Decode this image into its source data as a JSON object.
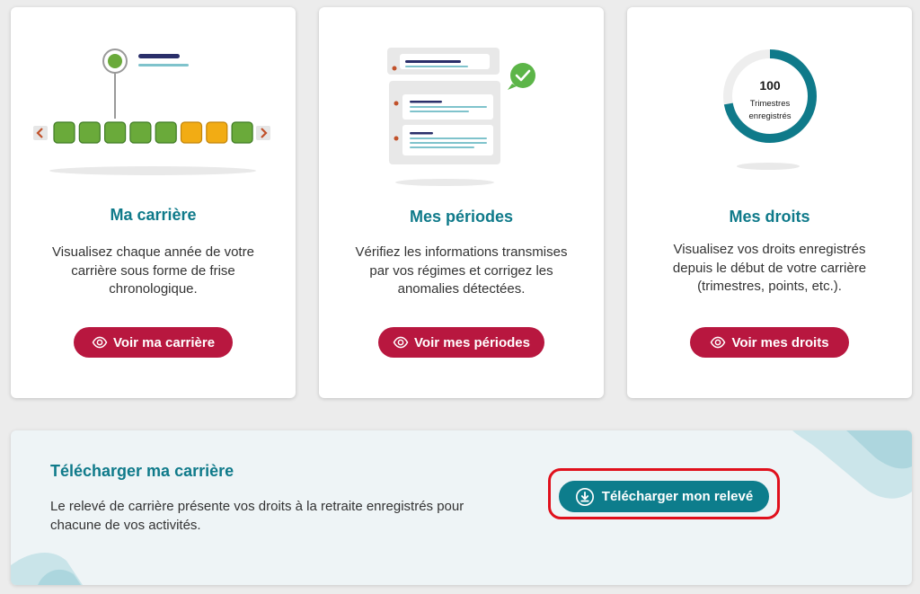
{
  "cards": [
    {
      "title": "Ma carrière",
      "description": "Visualisez chaque année de votre carrière sous forme de frise chronologique.",
      "button_label": "Voir ma carrière",
      "button_icon": "eye-icon"
    },
    {
      "title": "Mes périodes",
      "description": "Vérifiez les informations transmises par vos régimes et corrigez les anomalies détectées.",
      "button_label": "Voir mes périodes",
      "button_icon": "eye-icon"
    },
    {
      "title": "Mes droits",
      "description": "Visualisez vos droits enregistrés depuis le début de votre carrière (trimestres, points, etc.).",
      "button_label": "Voir mes droits",
      "button_icon": "eye-icon"
    }
  ],
  "droits_gauge": {
    "value": "100",
    "caption_line1": "Trimestres",
    "caption_line2": "enregistrés",
    "fill_fraction": 0.72
  },
  "timeline": {
    "blocks": [
      "green",
      "green",
      "green",
      "green",
      "green",
      "orange",
      "orange",
      "green"
    ],
    "prev_icon": "chevron-left-icon",
    "next_icon": "chevron-right-icon"
  },
  "download": {
    "title": "Télécharger ma carrière",
    "description": "Le relevé de carrière présente vos droits à la retraite enregistrés pour chacune de vos activités.",
    "button_label": "Télécharger mon relevé",
    "button_icon": "download-icon"
  },
  "colors": {
    "teal": "#0f7a8a",
    "crimson": "#b8173f",
    "green_block": "#6aaa3a",
    "orange_block": "#f2ac14",
    "highlight_red": "#e0101c"
  }
}
